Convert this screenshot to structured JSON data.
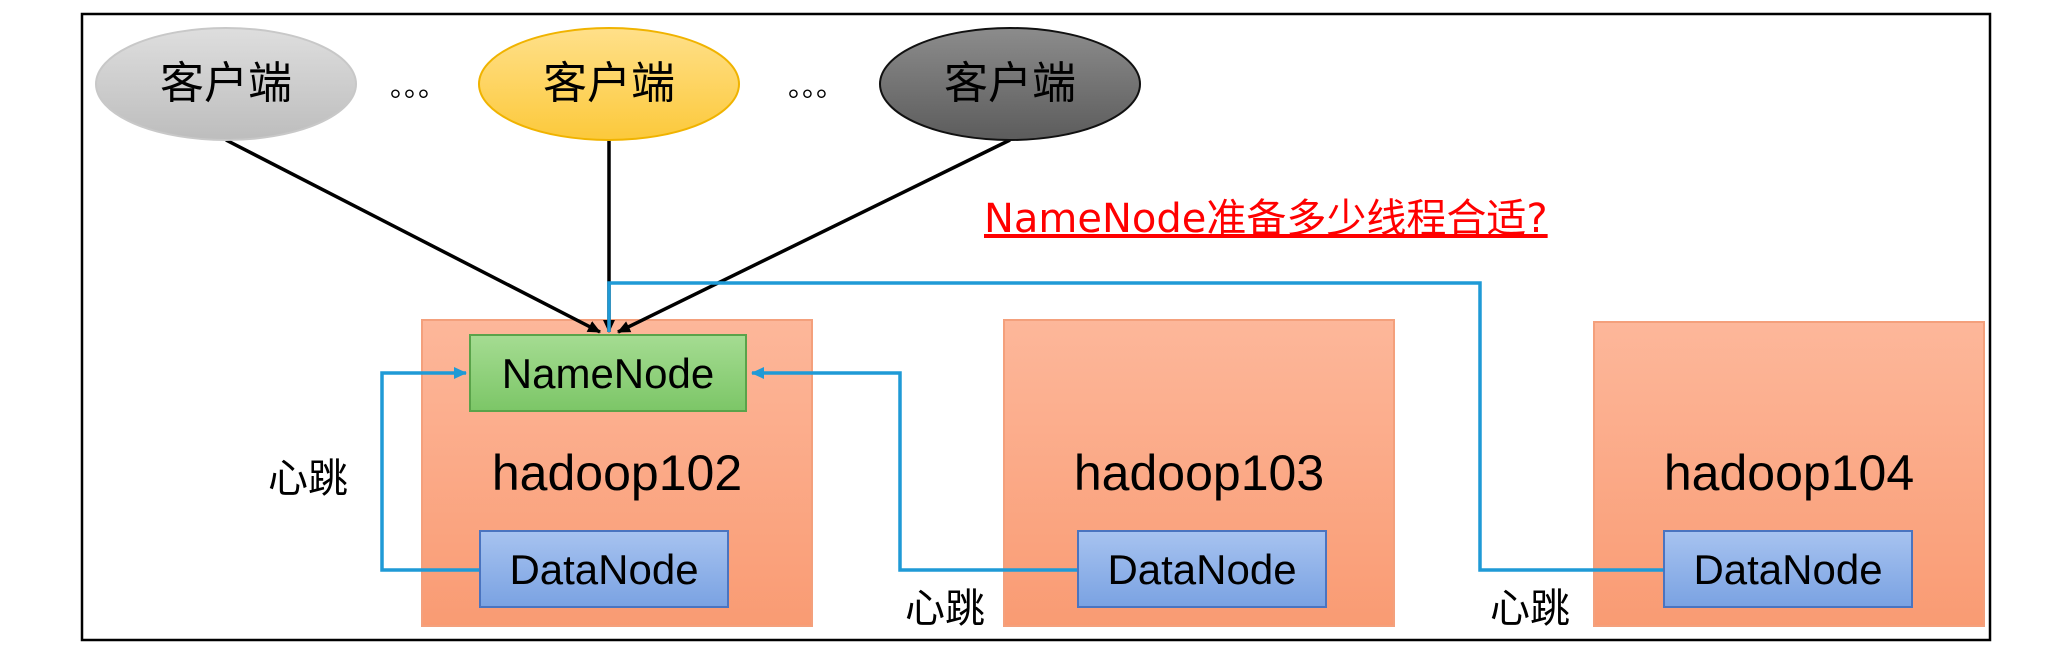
{
  "clients": [
    {
      "label": "客户端",
      "fill": "#d0d0d0"
    },
    {
      "label": "客户端",
      "fill": "#ffd966"
    },
    {
      "label": "客户端",
      "fill": "#7f7f7f"
    }
  ],
  "ellipsis": "。。。",
  "question": "NameNode准备多少线程合适?",
  "hosts": [
    {
      "name": "hadoop102",
      "datanode": "DataNode"
    },
    {
      "name": "hadoop103",
      "datanode": "DataNode"
    },
    {
      "name": "hadoop104",
      "datanode": "DataNode"
    }
  ],
  "namenode": "NameNode",
  "heartbeat": "心跳",
  "colors": {
    "host_fill": "#fcad89",
    "namenode_fill": "#8fd27c",
    "datanode_fill": "#8fb1e8",
    "connector": "#1f9ad6",
    "question": "#ff0000"
  }
}
